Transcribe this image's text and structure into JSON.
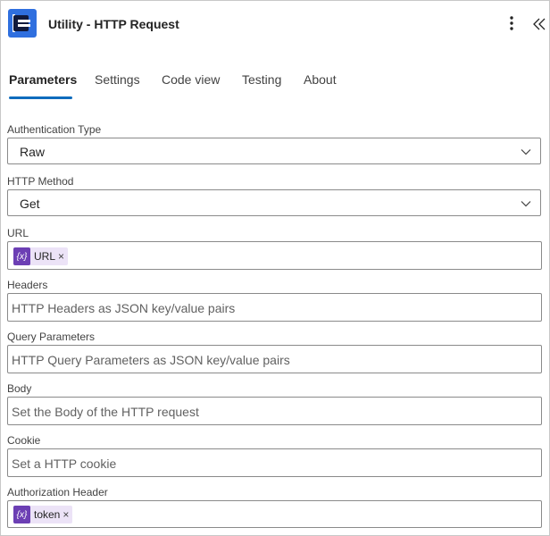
{
  "header": {
    "title": "Utility - HTTP Request",
    "app_icon": "utility-app-icon",
    "more_icon": "more-vertical-icon",
    "collapse_icon": "double-chevron-left-icon"
  },
  "tabs": [
    {
      "label": "Parameters",
      "active": true
    },
    {
      "label": "Settings",
      "active": false
    },
    {
      "label": "Code view",
      "active": false
    },
    {
      "label": "Testing",
      "active": false
    },
    {
      "label": "About",
      "active": false
    }
  ],
  "colors": {
    "accent": "#0f6cbd",
    "token_bg": "#ece3f7",
    "token_icon_bg": "#6c3fb4"
  },
  "fields": {
    "auth_type": {
      "label": "Authentication Type",
      "value": "Raw"
    },
    "http_method": {
      "label": "HTTP Method",
      "value": "Get"
    },
    "url": {
      "label": "URL",
      "token_icon": "{x}",
      "token_label": "URL",
      "token_remove": "×"
    },
    "headers": {
      "label": "Headers",
      "placeholder": "HTTP Headers as JSON key/value pairs"
    },
    "query": {
      "label": "Query Parameters",
      "placeholder": "HTTP Query Parameters as JSON key/value pairs"
    },
    "body": {
      "label": "Body",
      "placeholder": "Set the Body of the HTTP request"
    },
    "cookie": {
      "label": "Cookie",
      "placeholder": "Set a HTTP cookie"
    },
    "auth_header": {
      "label": "Authorization Header",
      "token_icon": "{x}",
      "token_label": "token",
      "token_remove": "×"
    }
  }
}
